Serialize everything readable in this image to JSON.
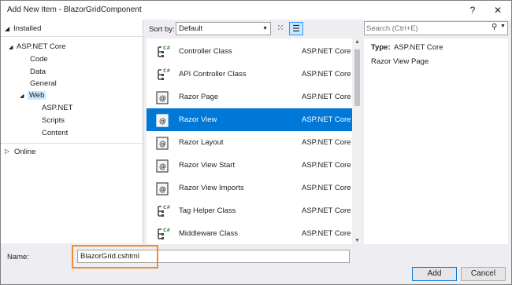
{
  "window": {
    "title": "Add New Item - BlazorGridComponent",
    "help_label": "?",
    "close_label": "✕"
  },
  "left": {
    "installed_label": "Installed",
    "tree": [
      {
        "label": "ASP.NET Core",
        "expander": "◢"
      },
      {
        "label": "Code"
      },
      {
        "label": "Data"
      },
      {
        "label": "General"
      },
      {
        "label": "Web",
        "expander": "◢"
      },
      {
        "label": "ASP.NET"
      },
      {
        "label": "Scripts"
      },
      {
        "label": "Content"
      }
    ],
    "online_label": "Online"
  },
  "sort": {
    "label": "Sort by:",
    "value": "Default"
  },
  "items": [
    {
      "name": "Controller Class",
      "category": "ASP.NET Core",
      "icon": "controller-class-icon"
    },
    {
      "name": "API Controller Class",
      "category": "ASP.NET Core",
      "icon": "controller-class-icon"
    },
    {
      "name": "Razor Page",
      "category": "ASP.NET Core",
      "icon": "razor-icon"
    },
    {
      "name": "Razor View",
      "category": "ASP.NET Core",
      "icon": "razor-icon"
    },
    {
      "name": "Razor Layout",
      "category": "ASP.NET Core",
      "icon": "razor-icon"
    },
    {
      "name": "Razor View Start",
      "category": "ASP.NET Core",
      "icon": "razor-icon"
    },
    {
      "name": "Razor View Imports",
      "category": "ASP.NET Core",
      "icon": "razor-icon"
    },
    {
      "name": "Tag Helper Class",
      "category": "ASP.NET Core",
      "icon": "controller-class-icon"
    },
    {
      "name": "Middleware Class",
      "category": "ASP.NET Core",
      "icon": "controller-class-icon"
    }
  ],
  "selected_item": "Razor View",
  "search": {
    "placeholder": "Search (Ctrl+E)"
  },
  "detail": {
    "type_label": "Type:",
    "type_value": "ASP.NET Core",
    "description": "Razor View Page"
  },
  "bottom": {
    "name_label": "Name:",
    "name_value": "BlazorGrid.cshtml",
    "add_label": "Add",
    "cancel_label": "Cancel"
  },
  "colors": {
    "selection": "#0078d7",
    "highlight_box": "#f38b35"
  }
}
